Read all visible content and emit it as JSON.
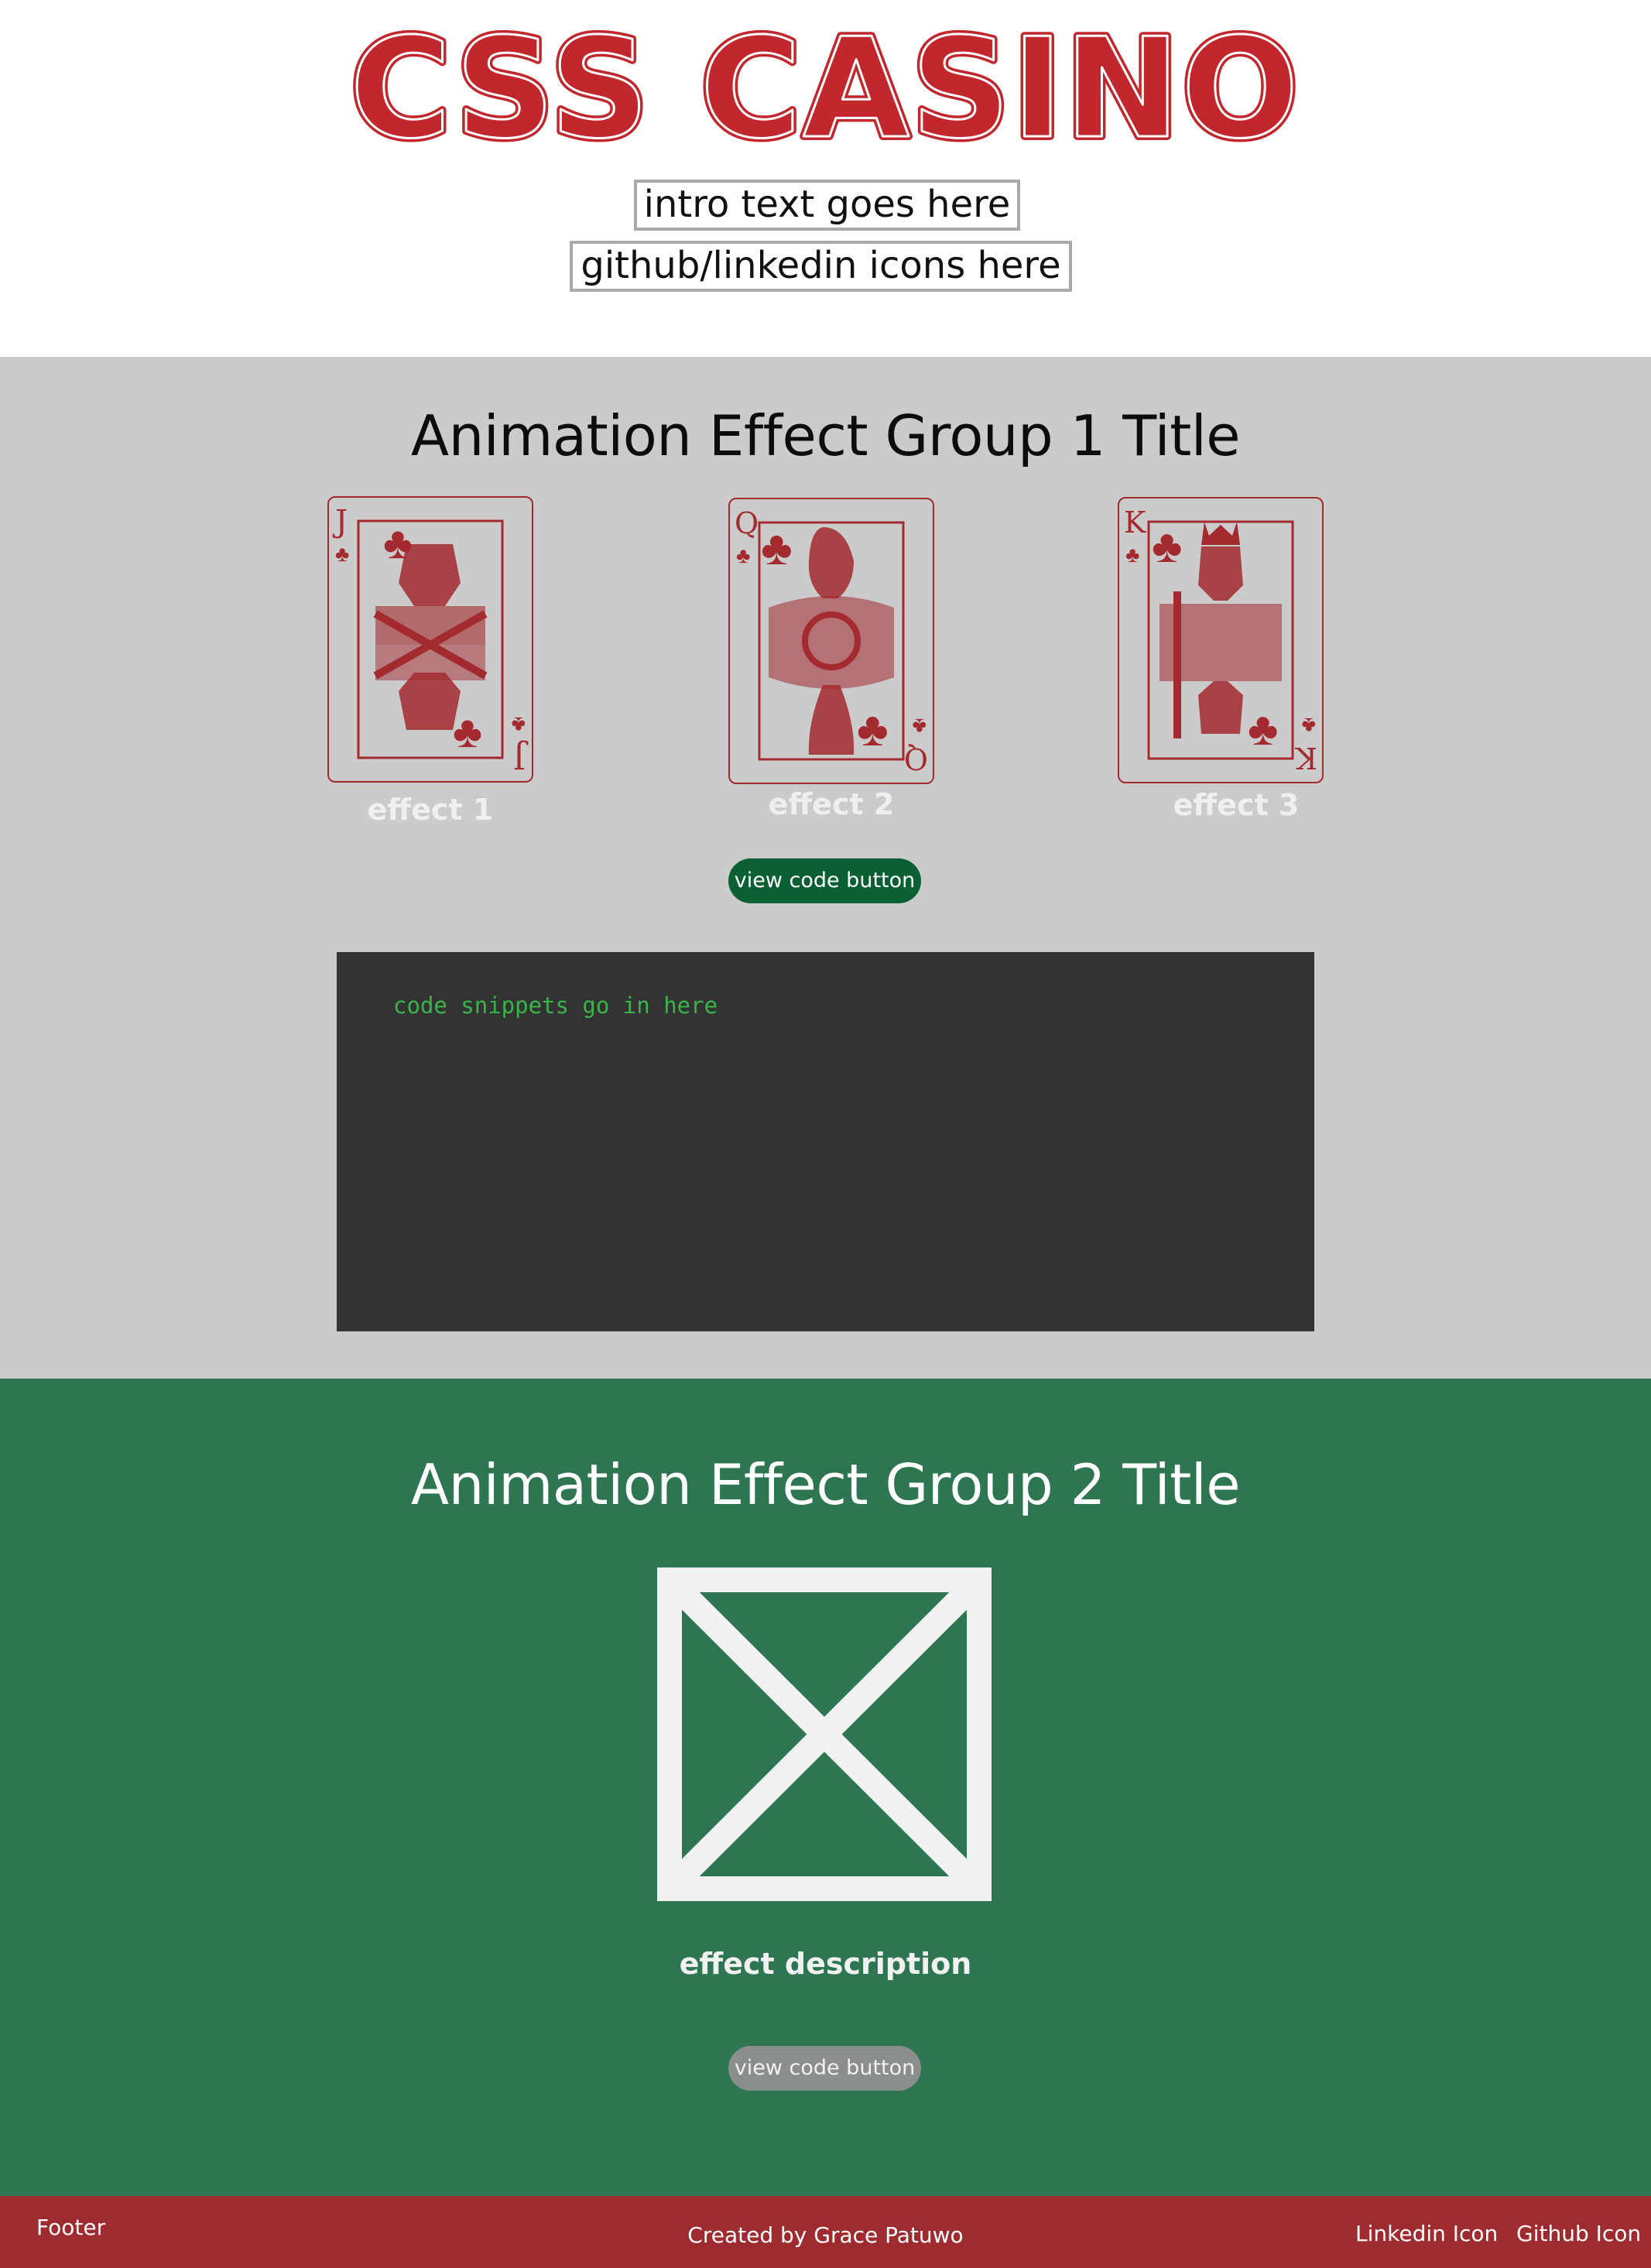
{
  "header": {
    "logo_text": "CSS CASINO",
    "intro_text": "intro text goes here",
    "social_text": "github/linkedin icons here"
  },
  "group1": {
    "title": "Animation Effect Group 1 Title",
    "cards": [
      {
        "rank": "J",
        "suit": "clubs",
        "label": "effect 1"
      },
      {
        "rank": "Q",
        "suit": "clubs",
        "label": "effect 2"
      },
      {
        "rank": "K",
        "suit": "clubs",
        "label": "effect 3"
      }
    ],
    "button_label": "view code button",
    "code_placeholder": "code snippets go in here"
  },
  "group2": {
    "title": "Animation Effect Group 2 Title",
    "image_icon": "image-placeholder-icon",
    "description": "effect description",
    "button_label": "view code button"
  },
  "footer": {
    "label": "Footer",
    "credit": "Created by Grace Patuwo",
    "linkedin": "Linkedin Icon",
    "github": "Github Icon"
  },
  "colors": {
    "brand_red": "#c1272d",
    "card_red": "#a32a2f",
    "section1_bg": "#cbcbcb",
    "section2_bg": "#2d7651",
    "button_green": "#0a6033",
    "button_grey": "#8a8f8c",
    "code_bg": "#333333",
    "code_text": "#3ab54a",
    "footer_bg": "#9e2b2f"
  }
}
